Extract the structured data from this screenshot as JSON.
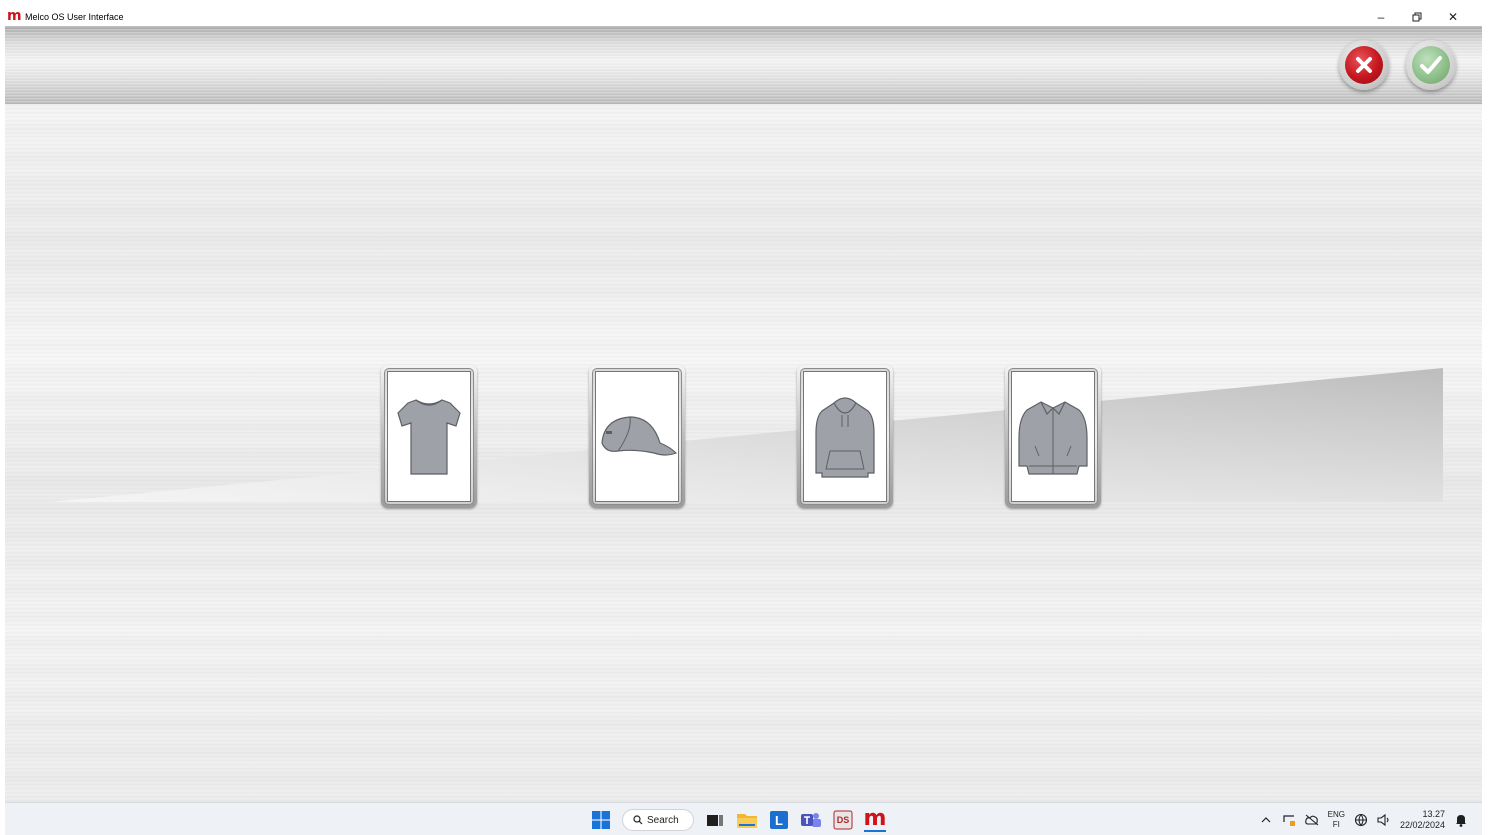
{
  "window": {
    "app_logo": "m",
    "title": "Melco OS User Interface",
    "minimize_symbol": "–",
    "restore_symbol": "❐",
    "close_symbol": "✕"
  },
  "toolbar": {
    "cancel_icon": "x-icon",
    "confirm_icon": "check-icon",
    "cancel_color": "#c5161e",
    "confirm_color": "#8fc08b"
  },
  "garments": [
    {
      "icon": "t-shirt-icon"
    },
    {
      "icon": "cap-icon"
    },
    {
      "icon": "hoodie-icon"
    },
    {
      "icon": "jacket-icon"
    }
  ],
  "taskbar": {
    "search_label": "Search",
    "apps": [
      "start-icon",
      "search",
      "task-view-icon",
      "file-explorer-icon",
      "l-app-icon",
      "teams-icon",
      "ds-app-icon",
      "melco-app-icon"
    ],
    "melco_logo": "m",
    "ds_label": "DS",
    "l_label": "L",
    "lang_top": "ENG",
    "lang_bottom": "FI",
    "time": "13.27",
    "date": "22/02/2024"
  }
}
